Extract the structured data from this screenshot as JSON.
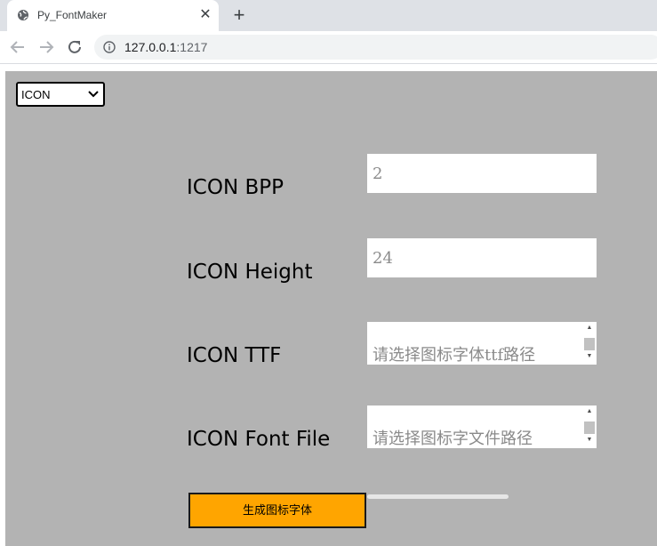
{
  "browser": {
    "tab_title": "Py_FontMaker",
    "tab_close": "✕",
    "new_tab": "+",
    "url_host": "127.0.0.1",
    "url_port": ":1217"
  },
  "form": {
    "mode_select": {
      "value": "ICON"
    },
    "fields": [
      {
        "label": "ICON BPP",
        "placeholder": "2"
      },
      {
        "label": "ICON Height",
        "placeholder": "24"
      },
      {
        "label": "ICON TTF",
        "placeholder": "请选择图标字体ttf路径"
      },
      {
        "label": "ICON Font File",
        "placeholder": "请选择图标字文件路径"
      }
    ],
    "generate_button": "生成图标字体",
    "progress": 0
  },
  "colors": {
    "content_bg": "#b3b3b3",
    "button_bg": "#ffa500"
  }
}
